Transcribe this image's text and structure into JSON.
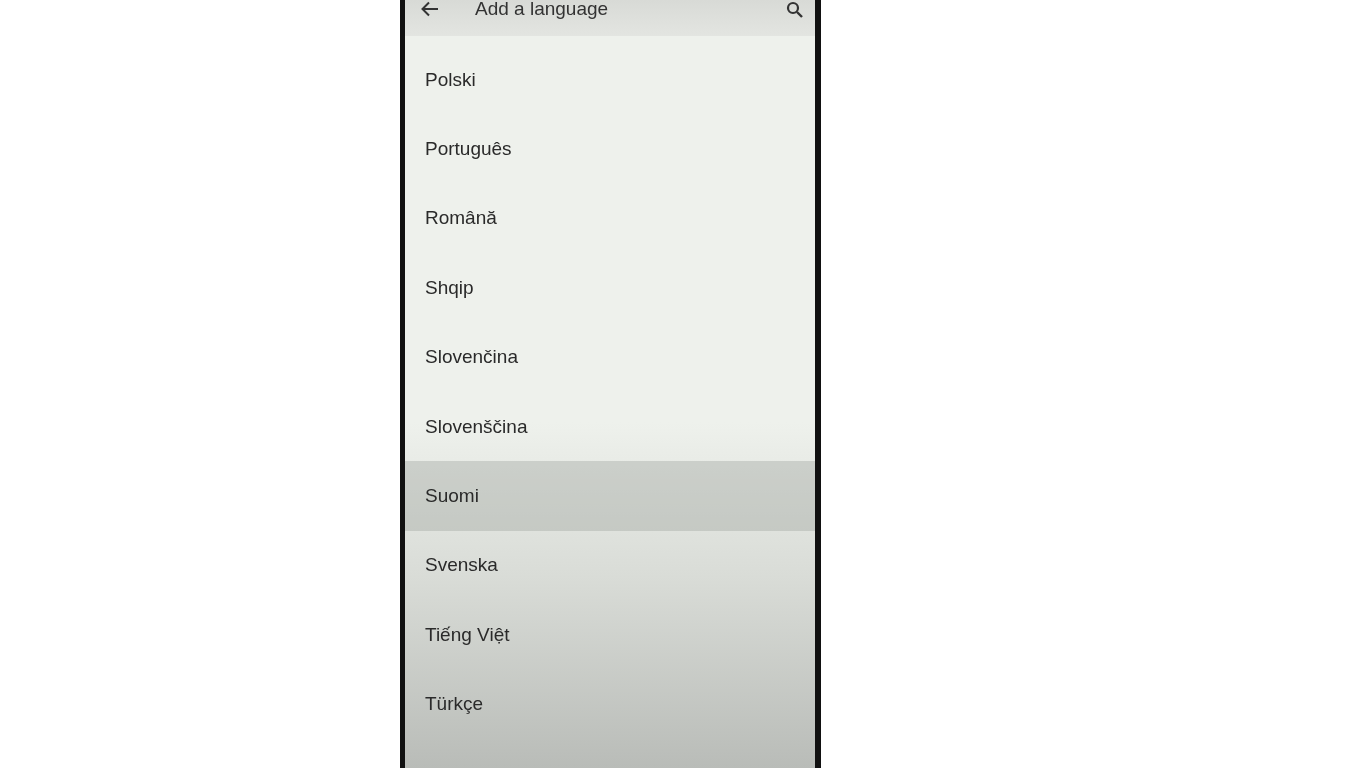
{
  "app_bar": {
    "title": "Add a language"
  },
  "languages": [
    {
      "name": "Polski",
      "selected": false
    },
    {
      "name": "Português",
      "selected": false
    },
    {
      "name": "Română",
      "selected": false
    },
    {
      "name": "Shqip",
      "selected": false
    },
    {
      "name": "Slovenčina",
      "selected": false
    },
    {
      "name": "Slovenščina",
      "selected": false
    },
    {
      "name": "Suomi",
      "selected": true
    },
    {
      "name": "Svenska",
      "selected": false
    },
    {
      "name": "Tiếng Việt",
      "selected": false
    },
    {
      "name": "Türkçe",
      "selected": false
    }
  ]
}
